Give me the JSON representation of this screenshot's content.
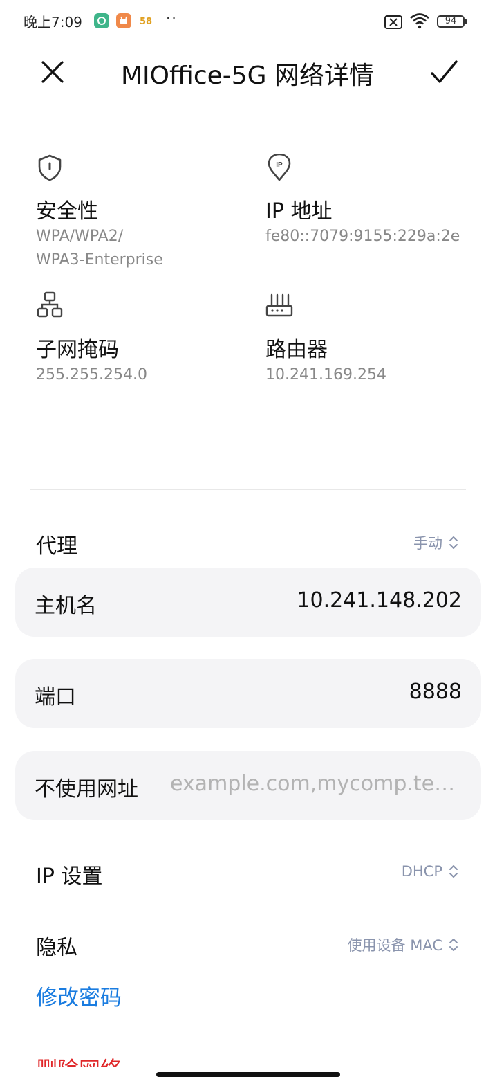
{
  "status_bar": {
    "time": "晚上7:09",
    "badge_3_text": "58",
    "dots": "··",
    "battery": "94"
  },
  "header": {
    "title": "MIOffice-5G 网络详情"
  },
  "info": {
    "security": {
      "label": "安全性",
      "value_line1": "WPA/WPA2/",
      "value_line2": "WPA3-Enterprise"
    },
    "ip_address": {
      "label": "IP 地址",
      "value": "fe80::7079:9155:229a:2e"
    },
    "subnet_mask": {
      "label": "子网掩码",
      "value": "255.255.254.0"
    },
    "router": {
      "label": "路由器",
      "value": "10.241.169.254"
    }
  },
  "proxy": {
    "label": "代理",
    "value": "手动",
    "hostname": {
      "label": "主机名",
      "value": "10.241.148.202"
    },
    "port": {
      "label": "端口",
      "value": "8888"
    },
    "bypass": {
      "label": "不使用网址",
      "placeholder": "example.com,mycomp.test.com,localhost"
    }
  },
  "ip_settings": {
    "label": "IP 设置",
    "value": "DHCP"
  },
  "privacy": {
    "label": "隐私",
    "value": "使用设备 MAC"
  },
  "actions": {
    "change_password": "修改密码",
    "delete_network": "删除网络"
  },
  "colors": {
    "link_blue": "#1a7ce0",
    "danger_red": "#e0282a",
    "value_gray_blue": "#8a94ad",
    "card_bg": "#f4f4f6"
  }
}
